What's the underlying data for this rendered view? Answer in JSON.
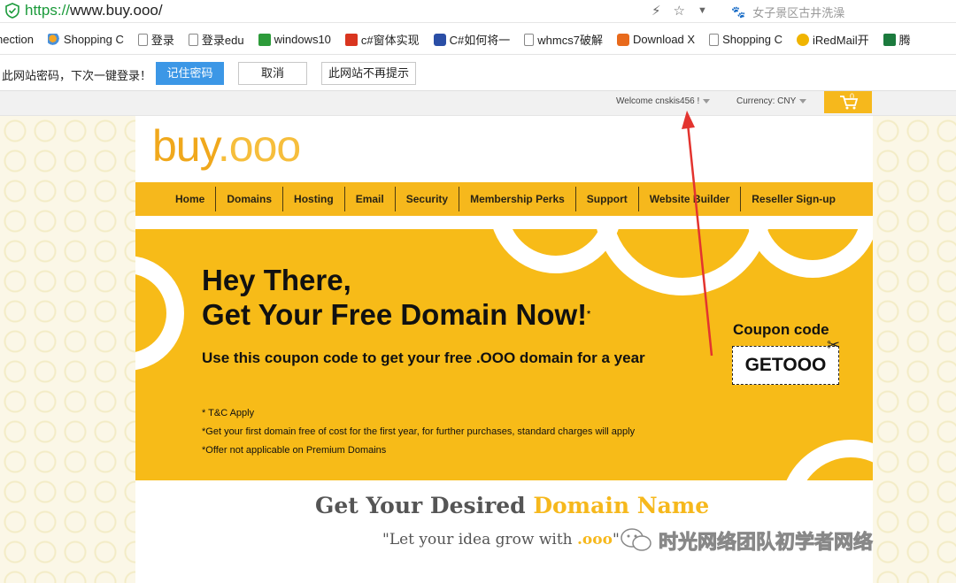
{
  "browser": {
    "url_protocol": "https://",
    "url_rest": "www.buy.ooo/",
    "search_placeholder": "女子景区古井洗澡"
  },
  "bookmarks": [
    {
      "label": "nection",
      "icon": "doc-icon"
    },
    {
      "label": "Shopping C",
      "icon": "shopping-icon"
    },
    {
      "label": "登录",
      "icon": "doc-icon"
    },
    {
      "label": "登录edu",
      "icon": "doc-icon"
    },
    {
      "label": "windows10",
      "icon": "windows-icon"
    },
    {
      "label": "c#窗体实现",
      "icon": "c-icon"
    },
    {
      "label": "C#如何将一",
      "icon": "paw-icon"
    },
    {
      "label": "whmcs7破解",
      "icon": "doc-icon"
    },
    {
      "label": "Download X",
      "icon": "download-icon"
    },
    {
      "label": "Shopping C",
      "icon": "doc-icon"
    },
    {
      "label": "iRedMail开",
      "icon": "iredmail-icon"
    },
    {
      "label": "腾",
      "icon": "chart-icon"
    }
  ],
  "save_password": {
    "message": "此网站密码，下次一键登录！",
    "remember_label": "记住密码",
    "cancel_label": "取消",
    "never_label": "此网站不再提示"
  },
  "topbar": {
    "welcome": "Welcome cnskis456 !",
    "currency_label": "Currency:",
    "currency_value": "CNY",
    "cart_count": "0"
  },
  "logo": {
    "main": "buy",
    "suffix": ".ooo"
  },
  "nav": [
    "Home",
    "Domains",
    "Hosting",
    "Email",
    "Security",
    "Membership Perks",
    "Support",
    "Website Builder",
    "Reseller Sign-up"
  ],
  "hero": {
    "title_line1": "Hey There,",
    "title_line2": "Get Your Free Domain Now!",
    "title_mark": "*",
    "subtitle": "Use this coupon code to get your free .OOO domain for a year",
    "coupon_label": "Coupon code",
    "coupon_code": "GETOOO",
    "terms": [
      "* T&C Apply",
      "*Get your first domain free of cost for the first year, for further purchases, standard charges will apply",
      "*Offer not applicable on Premium Domains"
    ]
  },
  "search_section": {
    "heading_plain": "Get Your Desired ",
    "heading_accent": "Domain Name",
    "tagline_plain": "\"Let your idea grow with ",
    "tagline_accent": ".ooo",
    "tagline_end": "\""
  },
  "watermark": "时光网络团队初学者网络",
  "colors": {
    "brand": "#f6b81c",
    "annotation": "#e3342f"
  }
}
